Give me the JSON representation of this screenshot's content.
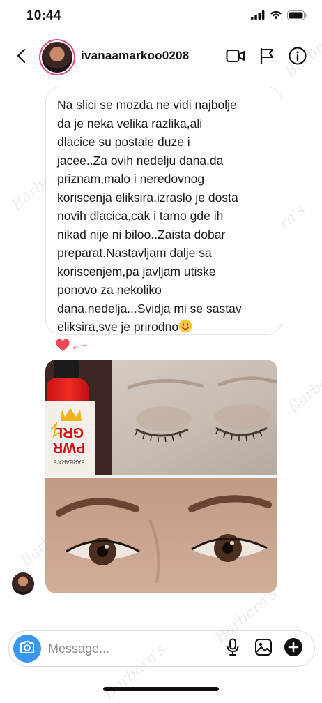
{
  "status_bar": {
    "time": "10:44",
    "icons": [
      "signal-icon",
      "wifi-icon",
      "battery-icon"
    ]
  },
  "header": {
    "username": "ivanaamarkoo0208",
    "icons": [
      "back-icon",
      "video-call-icon",
      "flag-icon",
      "info-icon"
    ]
  },
  "message": {
    "text": "Na slici se mozda ne vidi najbolje\nda je neka velika razlika,ali\ndlacice su postale duze i\njacee..Za ovih nedelju dana,da\npriznam,malo i neredovnog\nkoriscenja eliksira,izraslo je dosta\nnovih dlacica,cak i tamo gde ih\nnikad nije ni biloo..Zaista dobar\npreparat.Nastavljam dalje sa\nkoriscenjem,pa javljam utiske\nponovo za nekoliko\ndana,nedelja...Svidja mi se sastav\neliksira,sve je prirodno",
    "emoji": "smiling-face-icon",
    "reaction": "heart-icon"
  },
  "photo": {
    "bottle_label_line1": "GRL",
    "bottle_label_line2": "PWR",
    "bottle_brand": "BARBARA'S"
  },
  "composer": {
    "placeholder": "Message...",
    "icons": [
      "camera-icon",
      "microphone-icon",
      "gallery-icon",
      "add-icon"
    ]
  },
  "colors": {
    "accent": "#3897f0",
    "heart": "#ed4956",
    "text": "#1a1a1a",
    "placeholder": "#8e8e8e"
  }
}
